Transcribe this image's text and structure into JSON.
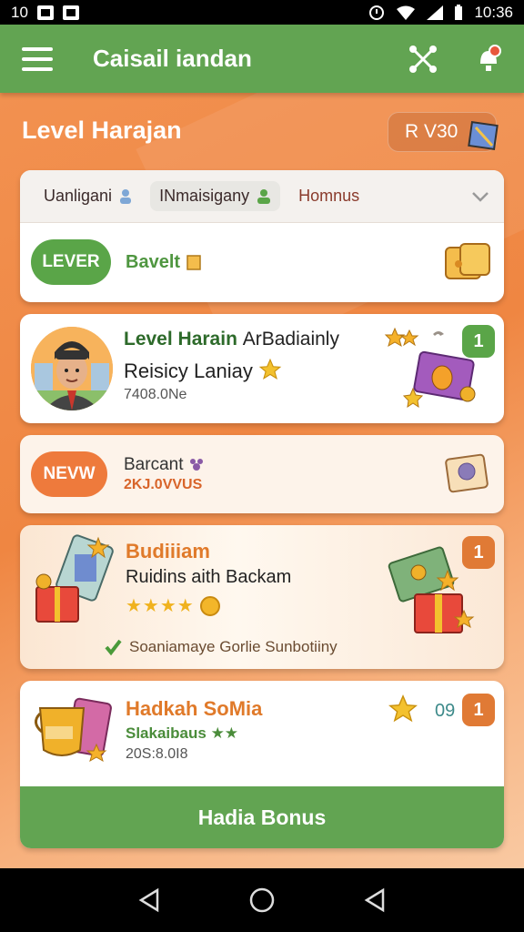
{
  "status": {
    "left_time": "10",
    "time": "10:36"
  },
  "app_bar": {
    "title": "Caisail iandan"
  },
  "page": {
    "level_title": "Level Harajan",
    "rv_badge": "R V30"
  },
  "tabs": {
    "items": [
      "Uanligani",
      "INmaisigany",
      "Homnus"
    ]
  },
  "lever": {
    "pill": "LEVER",
    "label": "Bavelt"
  },
  "level_card": {
    "title_green": "Level Harain",
    "title_dark": "ArBadiainly",
    "subtitle": "Reisicy Laniay",
    "date": "7408.0Ne",
    "badge": "1"
  },
  "new_card": {
    "pill": "NEVW",
    "title": "Barcant",
    "subtitle": "2KJ.0VVUS"
  },
  "reward_card": {
    "title": "Budiiiam",
    "subtitle": "Ruidins aith Backam",
    "stars": "★★★★",
    "footer": "Soaniamaye Gorlie Sunbotiiny",
    "badge": "1"
  },
  "bottom_card": {
    "title": "Hadkah SoMia",
    "subtitle": "Slakaibaus",
    "stars": "★★",
    "date": "20S:8.0I8",
    "extra": "09",
    "badge": "1",
    "button": "Hadia Bonus"
  },
  "colors": {
    "green": "#62a452",
    "orange": "#ee7a3c",
    "accent_text": "#e07a2a"
  },
  "icons": [
    "menu-icon",
    "share-icon",
    "notification-icon",
    "chevron-down-icon",
    "check-icon",
    "star-icon",
    "gift-icon"
  ]
}
